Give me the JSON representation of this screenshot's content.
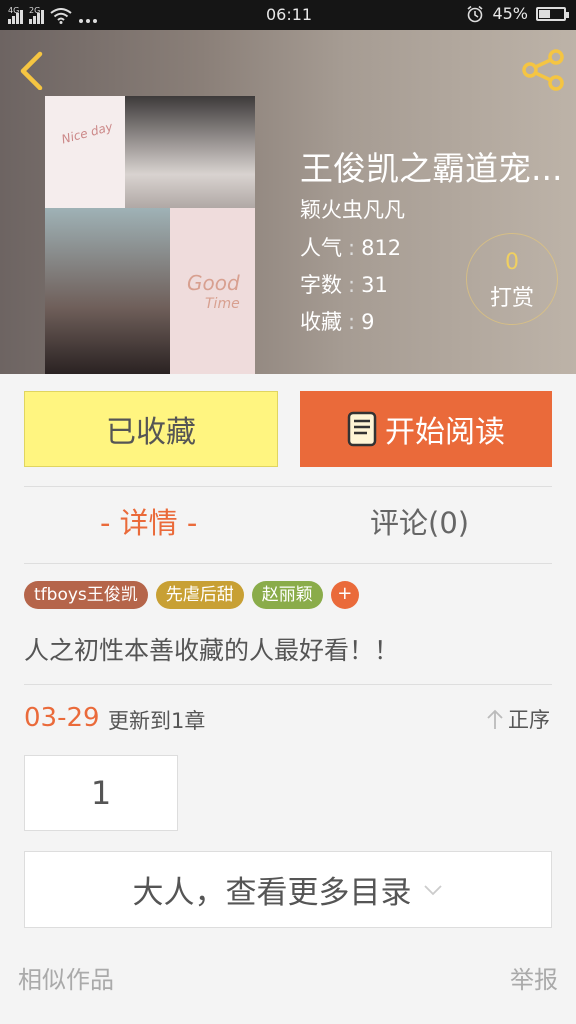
{
  "status_bar": {
    "net1": "4G",
    "net2": "2G",
    "time": "06:11",
    "battery": "45%",
    "battery_level": 0.45,
    "icons": [
      "signal-icon",
      "signal-icon",
      "wifi-icon",
      "more-dots-icon",
      "alarm-icon",
      "battery-icon"
    ]
  },
  "header": {
    "back_icon": "chevron-left-icon",
    "share_icon": "share-icon",
    "accent": "#f5c542"
  },
  "book": {
    "title": "王俊凯之霸道宠...",
    "author": "颖火虫凡凡",
    "stats": [
      {
        "label": "人气",
        "value": "812"
      },
      {
        "label": "字数",
        "value": "31"
      },
      {
        "label": "收藏",
        "value": "9"
      }
    ],
    "stat_sep": ":",
    "cover_text": [
      "Nice day",
      "Good",
      "Time"
    ]
  },
  "tip": {
    "count": "0",
    "label": "打赏"
  },
  "actions": {
    "collected": "已收藏",
    "read": "开始阅读",
    "read_color": "#ea6a3a",
    "collected_color": "#fff580"
  },
  "tabs": {
    "detail": "- 详情 -",
    "comment": "评论(0)"
  },
  "tags": [
    {
      "label": "tfboys王俊凯",
      "color": "#b5654a"
    },
    {
      "label": "先虐后甜",
      "color": "#c8a034"
    },
    {
      "label": "赵丽颖",
      "color": "#8aac4a"
    }
  ],
  "tag_add": "+",
  "description": "人之初性本善收藏的人最好看！！",
  "update": {
    "date": "03-29",
    "text": "更新到1章",
    "order": "正序"
  },
  "chapters": [
    "1"
  ],
  "more_catalog": "大人，查看更多目录",
  "footer": {
    "similar": "相似作品",
    "report": "举报"
  }
}
